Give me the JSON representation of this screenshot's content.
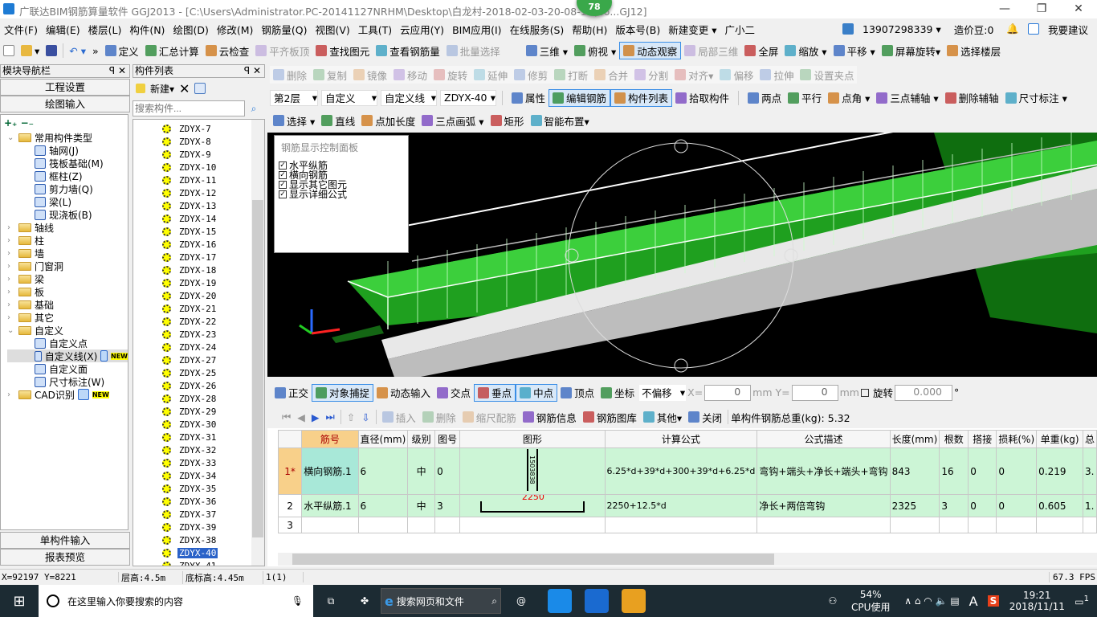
{
  "window": {
    "title": "广联达BIM钢筋算量软件 GGJ2013 - [C:\\Users\\Administrator.PC-20141127NRHM\\Desktop\\白龙村-2018-02-03-20-08-17(26...GJ12]",
    "badge": "78",
    "minimize": "—",
    "restore": "❐",
    "close": "✕"
  },
  "menu": [
    "文件(F)",
    "编辑(E)",
    "楼层(L)",
    "构件(N)",
    "绘图(D)",
    "修改(M)",
    "钢筋量(Q)",
    "视图(V)",
    "工具(T)",
    "云应用(Y)",
    "BIM应用(I)",
    "在线服务(S)",
    "帮助(H)",
    "版本号(B)",
    "新建变更 ▾",
    "广小二"
  ],
  "account": {
    "phone": "13907298339 ▾",
    "beans": "造价豆:0",
    "suggest": "我要建议"
  },
  "toolbar1": {
    "left": [
      "定义",
      "汇总计算",
      "云检查",
      "平齐板顶",
      "查找图元",
      "查看钢筋量",
      "批量选择"
    ],
    "right": [
      "三维 ▾",
      "俯视 ▾",
      "动态观察",
      "局部三维",
      "全屏",
      "缩放 ▾",
      "平移 ▾",
      "屏幕旋转▾",
      "选择楼层"
    ]
  },
  "nav": {
    "title": "模块导航栏",
    "btn_project": "工程设置",
    "btn_draw": "绘图输入",
    "btn_single": "单构件输入",
    "btn_report": "报表预览",
    "tree": [
      {
        "label": "常用构件类型",
        "level": 0,
        "open": true
      },
      {
        "label": "轴网(J)",
        "level": 1
      },
      {
        "label": "筏板基础(M)",
        "level": 1
      },
      {
        "label": "框柱(Z)",
        "level": 1
      },
      {
        "label": "剪力墙(Q)",
        "level": 1
      },
      {
        "label": "梁(L)",
        "level": 1
      },
      {
        "label": "现浇板(B)",
        "level": 1
      },
      {
        "label": "轴线",
        "level": 0
      },
      {
        "label": "柱",
        "level": 0
      },
      {
        "label": "墙",
        "level": 0
      },
      {
        "label": "门窗洞",
        "level": 0
      },
      {
        "label": "梁",
        "level": 0
      },
      {
        "label": "板",
        "level": 0
      },
      {
        "label": "基础",
        "level": 0
      },
      {
        "label": "其它",
        "level": 0
      },
      {
        "label": "自定义",
        "level": 0,
        "open": true
      },
      {
        "label": "自定义点",
        "level": 1
      },
      {
        "label": "自定义线(X)",
        "level": 1,
        "selected": true,
        "badge": "NEW"
      },
      {
        "label": "自定义面",
        "level": 1
      },
      {
        "label": "尺寸标注(W)",
        "level": 1
      },
      {
        "label": "CAD识别",
        "level": 0,
        "badge": "NEW"
      }
    ]
  },
  "complist": {
    "title": "构件列表",
    "new": "新建▾",
    "search_placeholder": "搜索构件...",
    "selected": "ZDYX-40",
    "items": [
      "ZDYX-7",
      "ZDYX-8",
      "ZDYX-9",
      "ZDYX-10",
      "ZDYX-11",
      "ZDYX-12",
      "ZDYX-13",
      "ZDYX-14",
      "ZDYX-15",
      "ZDYX-16",
      "ZDYX-17",
      "ZDYX-18",
      "ZDYX-19",
      "ZDYX-20",
      "ZDYX-21",
      "ZDYX-22",
      "ZDYX-23",
      "ZDYX-24",
      "ZDYX-27",
      "ZDYX-25",
      "ZDYX-26",
      "ZDYX-28",
      "ZDYX-29",
      "ZDYX-30",
      "ZDYX-31",
      "ZDYX-32",
      "ZDYX-33",
      "ZDYX-34",
      "ZDYX-35",
      "ZDYX-36",
      "ZDYX-37",
      "ZDYX-39",
      "ZDYX-38",
      "ZDYX-40",
      "ZDYX-41"
    ]
  },
  "edit_toolbar": [
    "删除",
    "复制",
    "镜像",
    "移动",
    "旋转",
    "延伸",
    "修剪",
    "打断",
    "合并",
    "分割",
    "对齐▾",
    "偏移",
    "拉伸",
    "设置夹点"
  ],
  "selector_bar": {
    "floor": "第2层",
    "type": "自定义",
    "subtype": "自定义线",
    "component": "ZDYX-40",
    "buttons": [
      "属性",
      "编辑钢筋",
      "构件列表",
      "拾取构件"
    ],
    "axis_tools": [
      "两点",
      "平行",
      "点角 ▾",
      "三点辅轴 ▾",
      "删除辅轴",
      "尺寸标注 ▾"
    ]
  },
  "draw_toolbar": [
    "选择 ▾",
    "直线",
    "点加长度",
    "三点画弧 ▾",
    "矩形",
    "智能布置▾"
  ],
  "control_panel": {
    "title": "钢筋显示控制面板",
    "items": [
      {
        "label": "水平纵筋",
        "checked": true
      },
      {
        "label": "横向钢筋",
        "checked": true
      },
      {
        "label": "显示其它图元",
        "checked": true
      },
      {
        "label": "显示详细公式",
        "checked": true
      }
    ]
  },
  "snap_bar": {
    "items": [
      "正交",
      "对象捕捉",
      "动态输入",
      "交点",
      "垂点",
      "中点",
      "顶点",
      "坐标"
    ],
    "offset": "不偏移",
    "x_label": "X=",
    "x": "0",
    "y_label": "mm Y=",
    "y": "0",
    "unit": "mm",
    "rotate_label": "旋转",
    "rotate": "0.000",
    "deg": "°"
  },
  "rebar_toolbar": {
    "items": [
      "插入",
      "删除",
      "缩尺配筋",
      "钢筋信息",
      "钢筋图库",
      "其他▾",
      "关闭"
    ],
    "total": "单构件钢筋总重(kg): 5.32"
  },
  "rebar_table": {
    "columns": [
      "",
      "筋号",
      "直径(mm)",
      "级别",
      "图号",
      "图形",
      "计算公式",
      "公式描述",
      "长度(mm)",
      "根数",
      "搭接",
      "损耗(%)",
      "单重(kg)",
      "总"
    ],
    "rows": [
      {
        "no": "1*",
        "name": "横向钢筋.1",
        "dia": "6",
        "grade": "中",
        "fig": "0",
        "shape_labels": [
          "150",
          "38",
          "38"
        ],
        "formula": "6.25*d+39*d+300+39*d+6.25*d",
        "desc": "弯钩+端头+净长+端头+弯钩",
        "len": "843",
        "count": "16",
        "lap": "0",
        "loss": "0",
        "unit_wt": "0.219",
        "total": "3."
      },
      {
        "no": "2",
        "name": "水平纵筋.1",
        "dia": "6",
        "grade": "中",
        "fig": "3",
        "shape_labels": [
          "2250"
        ],
        "formula": "2250+12.5*d",
        "desc": "净长+两倍弯钩",
        "len": "2325",
        "count": "3",
        "lap": "0",
        "loss": "0",
        "unit_wt": "0.605",
        "total": "1."
      },
      {
        "no": "3"
      }
    ]
  },
  "status": {
    "coords": "X=92197 Y=8221",
    "floor_h": "层高:4.5m",
    "base_h": "底标高:4.45m",
    "sel": "1(1)",
    "fps": "67.3 FPS"
  },
  "taskbar": {
    "search": "在这里输入你要搜索的内容",
    "browser_search": "搜索网页和文件",
    "cpu": "54%",
    "cpu_label": "CPU使用",
    "time": "19:21",
    "date": "2018/11/11",
    "notif": "1",
    "ime": "A"
  },
  "colors": {
    "accent": "#3a8ee6",
    "grid_green": "#ccf5d6",
    "canvas": "#000000",
    "model_green": "#1fa01f"
  }
}
